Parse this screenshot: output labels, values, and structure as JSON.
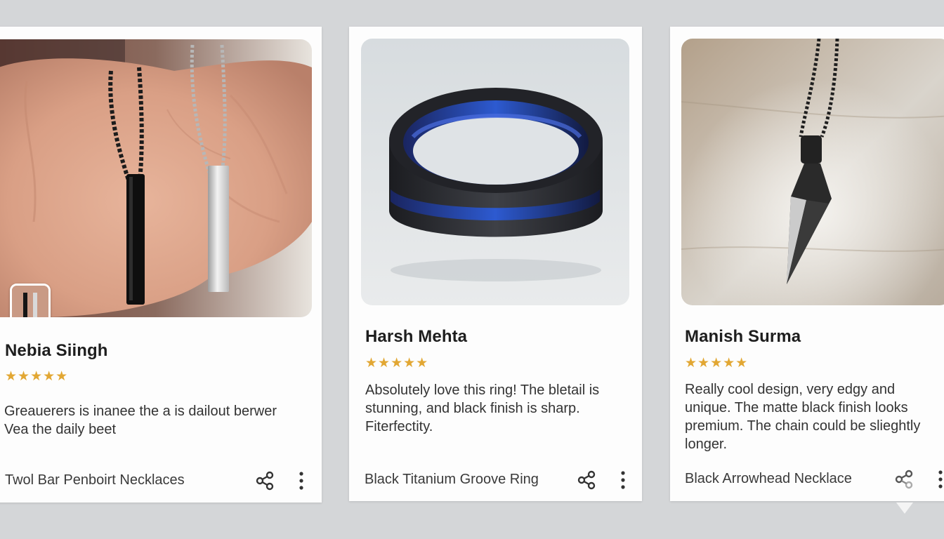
{
  "reviews": [
    {
      "reviewer": "Nebia Siingh",
      "stars": "★★★★★",
      "text": "Greauerers is inanee the a is dailout berwer Vea the daily beet",
      "product": "Twol Bar Penboirt Necklaces",
      "share_icon": "share-icon",
      "more_icon": "more-vertical-icon"
    },
    {
      "reviewer": "Harsh Mehta",
      "stars": "★★★★★",
      "text": "Absolutely love this ring! The bletail is  stunning, and black finish is sharp. Fiterfectity.",
      "product": "Black Titanium Groove Ring",
      "share_icon": "share-icon",
      "more_icon": "more-vertical-icon"
    },
    {
      "reviewer": "Manish Surma",
      "stars": "★★★★★",
      "text": "Really cool design, very edgy and unique. The matte black finish looks premium. The chain could be slieghtly longer.",
      "product": "Black Arrowhead Necklace",
      "share_icon": "share-icon",
      "more_icon": "more-vertical-icon"
    }
  ],
  "colors": {
    "star": "#e2a733",
    "background": "#d4d6d8",
    "card": "#fdfdfd"
  }
}
